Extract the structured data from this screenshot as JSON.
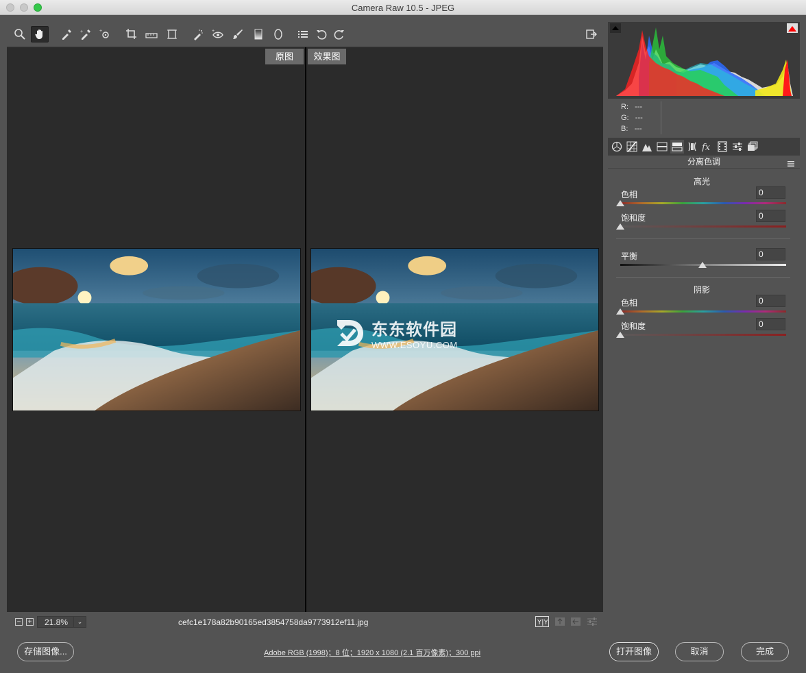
{
  "window": {
    "title": "Camera Raw 10.5 -  JPEG"
  },
  "toolbar": {
    "tools": [
      "zoom-tool",
      "hand-tool",
      "white-balance-tool",
      "color-sampler-tool",
      "targeted-adjustment-tool",
      "crop-tool",
      "straighten-tool",
      "transform-tool",
      "spot-removal-tool",
      "red-eye-tool",
      "adjustment-brush",
      "graduated-filter",
      "radial-filter",
      "preferences",
      "rotate-left",
      "rotate-right"
    ],
    "active_tool": "hand-tool"
  },
  "preview": {
    "before_label": "原图",
    "after_label": "效果图"
  },
  "watermark": {
    "main": "东东软件园",
    "sub": "WWW.ESOYU.COM"
  },
  "status": {
    "zoom": "21.8%",
    "filename": "cefc1e178a82b90165ed3854758da9773912ef11.jpg"
  },
  "readout": {
    "r_label": "R:",
    "r_value": "---",
    "g_label": "G:",
    "g_value": "---",
    "b_label": "B:",
    "b_value": "---"
  },
  "panel": {
    "title": "分离色调",
    "highlights": {
      "header": "高光",
      "hue_label": "色相",
      "hue_value": "0",
      "saturation_label": "饱和度",
      "saturation_value": "0"
    },
    "balance": {
      "label": "平衡",
      "value": "0"
    },
    "shadows": {
      "header": "阴影",
      "hue_label": "色相",
      "hue_value": "0",
      "saturation_label": "饱和度",
      "saturation_value": "0"
    }
  },
  "footer": {
    "save_label": "存储图像...",
    "workflow_info": "Adobe RGB (1998)；8 位；1920 x 1080 (2.1 百万像素)；300 ppi",
    "open_label": "打开图像",
    "cancel_label": "取消",
    "done_label": "完成"
  },
  "colors": {
    "accent_clip": "#ff0000",
    "panel_bg": "#535353",
    "preview_bg": "#2b2b2b"
  }
}
